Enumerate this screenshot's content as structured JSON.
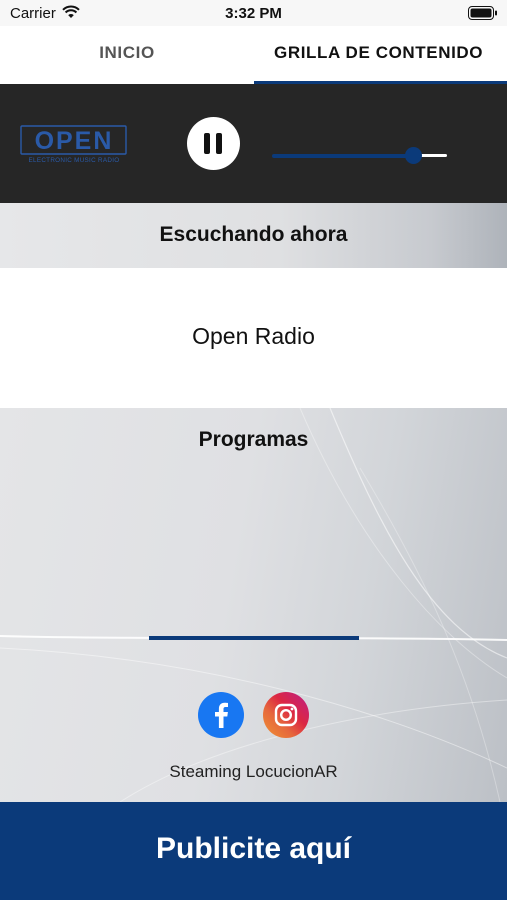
{
  "status_bar": {
    "carrier": "Carrier",
    "time": "3:32 PM"
  },
  "tabs": [
    {
      "label": "INICIO",
      "selected": false
    },
    {
      "label": "GRILLA DE CONTENIDO",
      "selected": true
    }
  ],
  "player": {
    "logo_text": "OPEN",
    "logo_subtext": "ELECTRONIC MUSIC RADIO",
    "state": "playing",
    "volume": 0.81
  },
  "now_playing": {
    "header": "Escuchando ahora",
    "station": "Open Radio"
  },
  "programs": {
    "title": "Programas"
  },
  "social": {
    "icons": [
      "facebook-icon",
      "instagram-icon"
    ]
  },
  "footer_credit": "Steaming LocucionAR",
  "ad_banner": {
    "label": "Publicite aquí"
  },
  "colors": {
    "accent": "#0b3a7a",
    "player_bg": "#262626",
    "facebook": "#1877f2"
  }
}
